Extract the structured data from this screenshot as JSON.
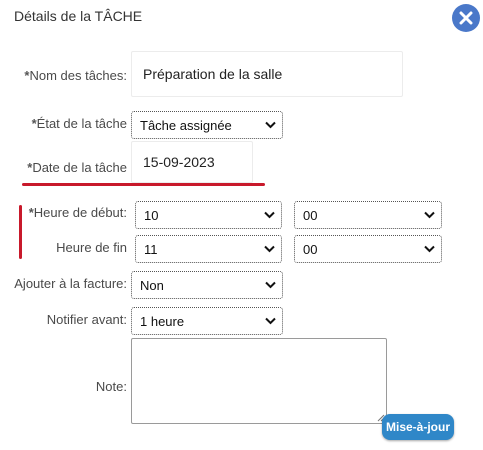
{
  "dialog": {
    "title": "Détails de la TÂCHE",
    "close_icon": "close-icon",
    "accent_color": "#4a78c9"
  },
  "form": {
    "task_name": {
      "label": "Nom des tâches:",
      "required": "*",
      "value": "Préparation de la salle"
    },
    "task_state": {
      "label": "État de la tâche",
      "required": "*",
      "value": "Tâche assignée"
    },
    "task_date": {
      "label": "Date de la tâche",
      "required": "*",
      "value": "15-09-2023"
    },
    "start_time": {
      "label": "Heure de début:",
      "required": "*",
      "hour": "10",
      "minute": "00"
    },
    "end_time": {
      "label": "Heure de fin",
      "hour": "11",
      "minute": "00"
    },
    "add_to_invoice": {
      "label": "Ajouter à la facture:",
      "value": "Non"
    },
    "notify_before": {
      "label": "Notifier avant:",
      "value": "1 heure"
    },
    "note": {
      "label": "Note:",
      "value": ""
    }
  },
  "actions": {
    "update_label": "Mise-à-jour"
  },
  "annotation_color": "#c8192b"
}
